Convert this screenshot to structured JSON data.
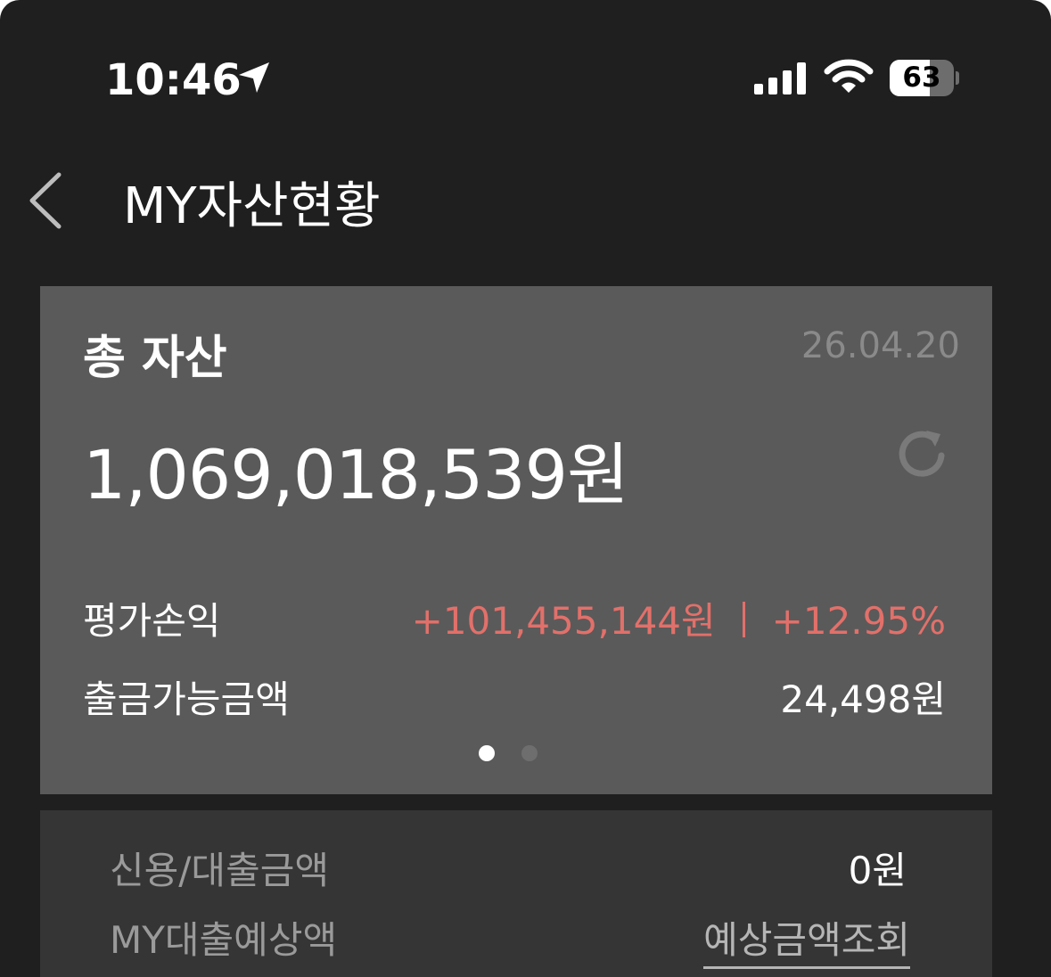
{
  "status_bar": {
    "time": "10:46",
    "battery_level": "63",
    "battery_fraction": 0.63
  },
  "header": {
    "title": "MY자산현황"
  },
  "summary": {
    "title": "총 자산",
    "date": "26.04.20",
    "total_amount": "1,069,018,539원",
    "profit_label": "평가손익",
    "profit_amount": "+101,455,144원",
    "profit_rate": "+12.95%",
    "withdrawable_label": "출금가능금액",
    "withdrawable_amount": "24,498원",
    "page_count": 2,
    "active_page": 1
  },
  "loan": {
    "credit_label": "신용/대출금액",
    "credit_value": "0원",
    "estimate_label": "MY대출예상액",
    "estimate_link": "예상금액조회"
  },
  "colors": {
    "background": "#1f1f1f",
    "card": "#5a5a5a",
    "loan_card": "#353535",
    "profit": "#e2706a",
    "dot_active": "#ffffff",
    "dot_inactive": "#6e6e6e"
  },
  "icons": {
    "location": "location-arrow-icon",
    "signal": "cellular-signal-icon",
    "wifi": "wifi-icon",
    "battery": "battery-icon",
    "back": "chevron-left-icon",
    "refresh": "refresh-icon"
  }
}
